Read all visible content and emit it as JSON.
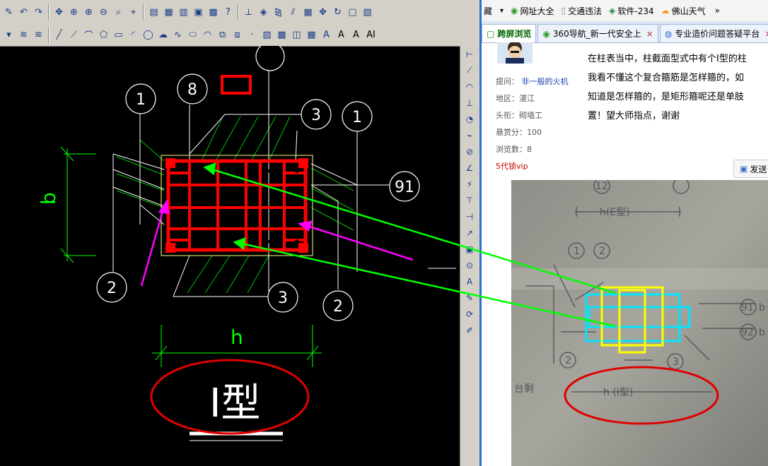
{
  "cad": {
    "toolbar1_icons": [
      "pen-icon",
      "undo-icon",
      "redo-icon",
      "pan-icon",
      "zoom-realtime-icon",
      "zoom-in-icon",
      "zoom-out-icon",
      "zoom-window-icon",
      "zoom-previous-icon",
      "properties-icon",
      "design-center-icon",
      "tool-palette-icon",
      "sheet-set-icon",
      "calculator-icon",
      "help-icon",
      "dimension-icon",
      "layer-icon",
      "mirror-icon",
      "offset-icon",
      "array-icon",
      "move-icon",
      "rotate-icon",
      "scale-icon",
      "stretch-icon"
    ],
    "toolbar2_icons": [
      "dropdown-arrow-icon",
      "layer-state-icon",
      "layer-previous-icon",
      "line-icon",
      "construction-line-icon",
      "polyline-icon",
      "polygon-icon",
      "rectangle-icon",
      "arc-icon",
      "circle-icon",
      "revision-cloud-icon",
      "spline-icon",
      "ellipse-icon",
      "ellipse-arc-icon",
      "insert-block-icon",
      "make-block-icon",
      "point-icon",
      "hatch-icon",
      "gradient-icon",
      "region-icon",
      "table-icon",
      "multiline-text-icon"
    ],
    "toolbar2_text": [
      "A",
      "A",
      "AI"
    ],
    "vertical_icons": [
      "linear-dim-icon",
      "aligned-dim-icon",
      "arc-length-icon",
      "ordinate-icon",
      "radius-icon",
      "jogged-icon",
      "diameter-icon",
      "angular-icon",
      "quick-dim-icon",
      "baseline-icon",
      "continue-icon",
      "leader-icon",
      "tolerance-icon",
      "center-mark-icon",
      "dim-edit-icon",
      "text-edit-icon",
      "dim-update-icon",
      "dim-style-icon"
    ],
    "drawing": {
      "labels": {
        "c1_left": "1",
        "c8": "8",
        "c3_top": "3",
        "c1_right": "1",
        "c91": "91",
        "c2_left": "2",
        "c3_bottom": "3",
        "c2_right": "2",
        "dim_b": "b",
        "dim_h": "h",
        "section_title": "I型"
      },
      "colors": {
        "rebar": "#ff0000",
        "hatch": "#00c000",
        "dim": "#00ff00",
        "outline": "#ffff80",
        "arrow_green": "#00ff00",
        "arrow_magenta": "#ff00ff",
        "ellipse": "#e00000",
        "white": "#ffffff"
      }
    }
  },
  "browser": {
    "bookmarks": [
      {
        "icon": "bookmark-icon",
        "label": "藏"
      },
      {
        "icon": "site-nav-icon",
        "label": "网址大全"
      },
      {
        "icon": "page-icon",
        "label": "交通违法"
      },
      {
        "icon": "software-icon",
        "label": "软件-234"
      },
      {
        "icon": "weather-icon",
        "label": "佛山天气"
      },
      {
        "icon": "more-icon",
        "label": "»"
      }
    ],
    "tabs": [
      {
        "label": "跨屏浏览",
        "active": true
      },
      {
        "label": "360导航_新一代安全上",
        "active": false
      },
      {
        "label": "专业造价问题答疑平台",
        "active": false
      }
    ],
    "question": {
      "asker_label": "提问：",
      "asker": "非一般的火机",
      "region_label": "地区：",
      "region": "湛江",
      "title_label": "头衔：",
      "title": "砌墙工",
      "reward_label": "悬赏分：",
      "reward": "100",
      "views_label": "浏览数：",
      "views": "8",
      "vip": "5代锁vip",
      "text_lines": [
        "在柱表当中，柱截面型式中有个I型的柱",
        "我看不懂这个复合箍筋是怎样箍的，如",
        "知道是怎样箍的，是矩形箍呢还是单肢",
        "置！望大师指点，谢谢"
      ],
      "send_label": "发送"
    },
    "photo_labels": {
      "h_e": "h(E型)",
      "h_i": "h (I型)",
      "c1": "1",
      "c2": "2",
      "c3": "3",
      "c12": "12",
      "c91": "91",
      "c92": "92",
      "c91_text": "b",
      "c92_text": "b",
      "side": "台剩"
    }
  }
}
